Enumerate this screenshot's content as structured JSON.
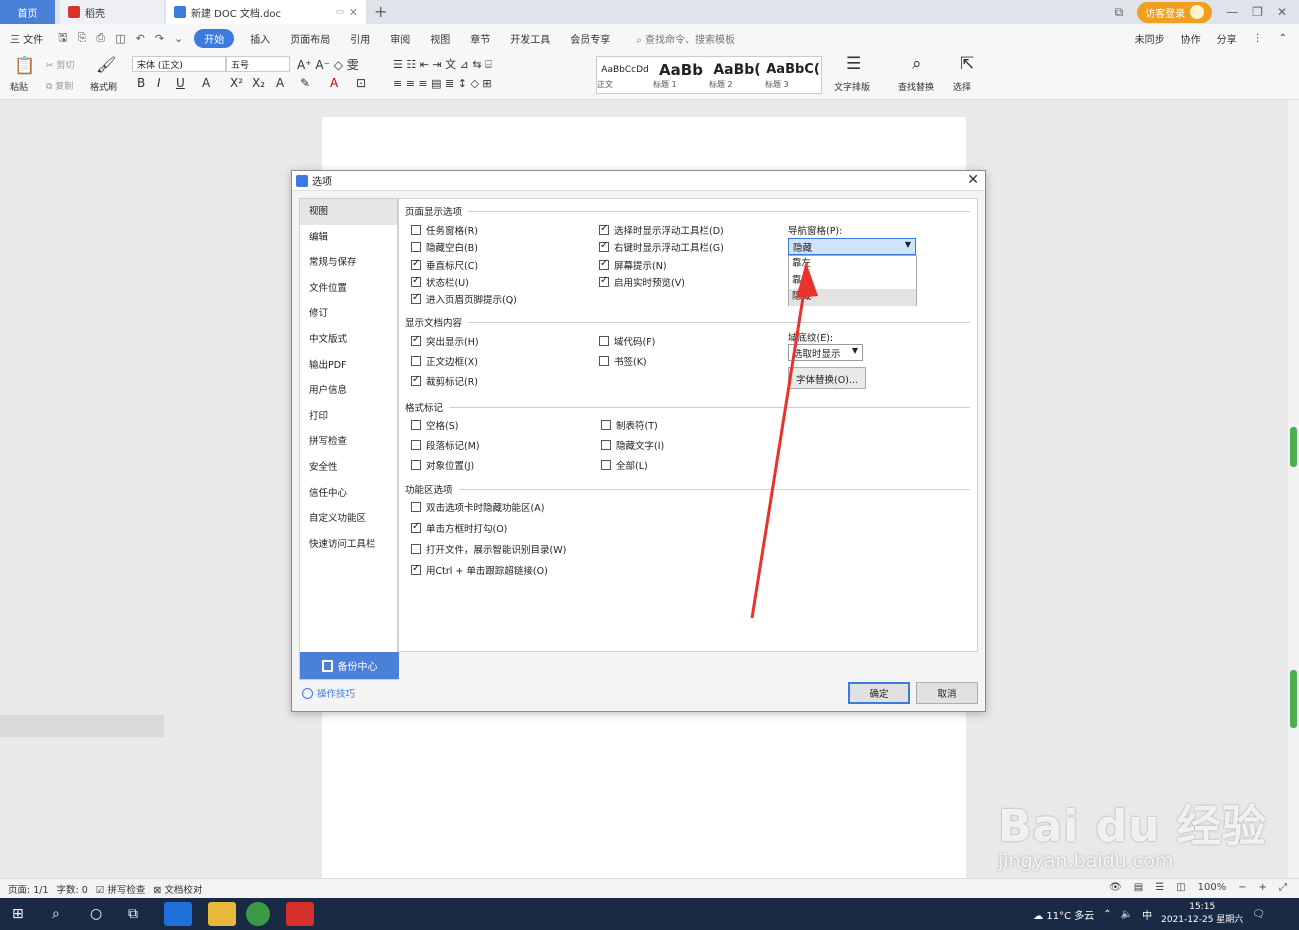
{
  "tabs": {
    "home": "首页",
    "daoke": "稻壳",
    "document": "新建 DOC 文档.doc",
    "new_tab": "+"
  },
  "title_bar": {
    "visitor_login": "访客登录"
  },
  "menu": {
    "file": "三 文件",
    "items": [
      "开始",
      "插入",
      "页面布局",
      "引用",
      "审阅",
      "视图",
      "章节",
      "开发工具",
      "会员专享"
    ],
    "search": "查找命令、搜索模板",
    "right": [
      "未同步",
      "协作",
      "分享"
    ]
  },
  "ribbon": {
    "paste": "粘贴",
    "cut": "剪切",
    "copy": "复制",
    "format_painter": "格式刷",
    "font_name": "宋体 (正文)",
    "font_size": "五号",
    "styles": [
      {
        "preview": "AaBbCcDd",
        "label": "正文"
      },
      {
        "preview": "AaBb",
        "label": "标题 1"
      },
      {
        "preview": "AaBb(",
        "label": "标题 2"
      },
      {
        "preview": "AaBbC(",
        "label": "标题 3"
      }
    ],
    "text_layout": "文字排版",
    "find_replace": "查找替换",
    "select": "选择"
  },
  "dialog": {
    "title": "选项",
    "nav": [
      "视图",
      "编辑",
      "常规与保存",
      "文件位置",
      "修订",
      "中文版式",
      "输出PDF",
      "用户信息",
      "打印",
      "拼写检查",
      "安全性",
      "信任中心",
      "自定义功能区",
      "快速访问工具栏"
    ],
    "backup_center": "备份中心",
    "tips": "操作技巧",
    "sections": {
      "page_display": "页面显示选项",
      "doc_content": "显示文档内容",
      "format_marks": "格式标记",
      "ribbon_options": "功能区选项"
    },
    "page_display_left": [
      {
        "label": "任务窗格(R)",
        "checked": false
      },
      {
        "label": "隐藏空白(B)",
        "checked": false
      },
      {
        "label": "垂直标尺(C)",
        "checked": true
      },
      {
        "label": "状态栏(U)",
        "checked": true
      },
      {
        "label": "进入页眉页脚提示(Q)",
        "checked": true
      }
    ],
    "page_display_right": [
      {
        "label": "选择时显示浮动工具栏(D)",
        "checked": true
      },
      {
        "label": "右键时显示浮动工具栏(G)",
        "checked": true
      },
      {
        "label": "屏幕提示(N)",
        "checked": true
      },
      {
        "label": "启用实时预览(V)",
        "checked": true
      }
    ],
    "nav_pane_label": "导航窗格(P):",
    "nav_pane_value": "隐藏",
    "nav_pane_options": [
      "靠左",
      "靠右",
      "隐藏"
    ],
    "field_shading_label": "域底纹(E):",
    "field_shading_value": "选取时显示",
    "font_replace": "字体替换(O)...",
    "doc_content_left": [
      {
        "label": "突出显示(H)",
        "checked": true
      },
      {
        "label": "正文边框(X)",
        "checked": false
      },
      {
        "label": "裁剪标记(R)",
        "checked": true
      }
    ],
    "doc_content_right": [
      {
        "label": "域代码(F)",
        "checked": false
      },
      {
        "label": "书签(K)",
        "checked": false
      }
    ],
    "format_marks_left": [
      {
        "label": "空格(S)",
        "checked": false
      },
      {
        "label": "段落标记(M)",
        "checked": false
      },
      {
        "label": "对象位置(J)",
        "checked": false
      }
    ],
    "format_marks_right": [
      {
        "label": "制表符(T)",
        "checked": false
      },
      {
        "label": "隐藏文字(I)",
        "checked": false
      },
      {
        "label": "全部(L)",
        "checked": false
      }
    ],
    "ribbon_options": [
      {
        "label": "双击选项卡时隐藏功能区(A)",
        "checked": false
      },
      {
        "label": "单击方框时打勾(O)",
        "checked": true
      },
      {
        "label": "打开文件，展示智能识别目录(W)",
        "checked": false
      },
      {
        "label": "用Ctrl + 单击跟踪超链接(O)",
        "checked": true
      }
    ],
    "ok": "确定",
    "cancel": "取消"
  },
  "status": {
    "page": "页面: 1/1",
    "words": "字数: 0",
    "spell": "拼写检查",
    "proof": "文档校对",
    "zoom": "100%"
  },
  "taskbar": {
    "weather": "11°C 多云",
    "ime": "中",
    "time": "15:15",
    "date": "2021-12-25 星期六"
  },
  "watermark": {
    "brand": "Bai du 经验",
    "url": "jingyan.baidu.com"
  },
  "colors": {
    "accent": "#3b7be0",
    "annotation_arrow": "#e8322a",
    "taskbar": "#1b2a44"
  }
}
